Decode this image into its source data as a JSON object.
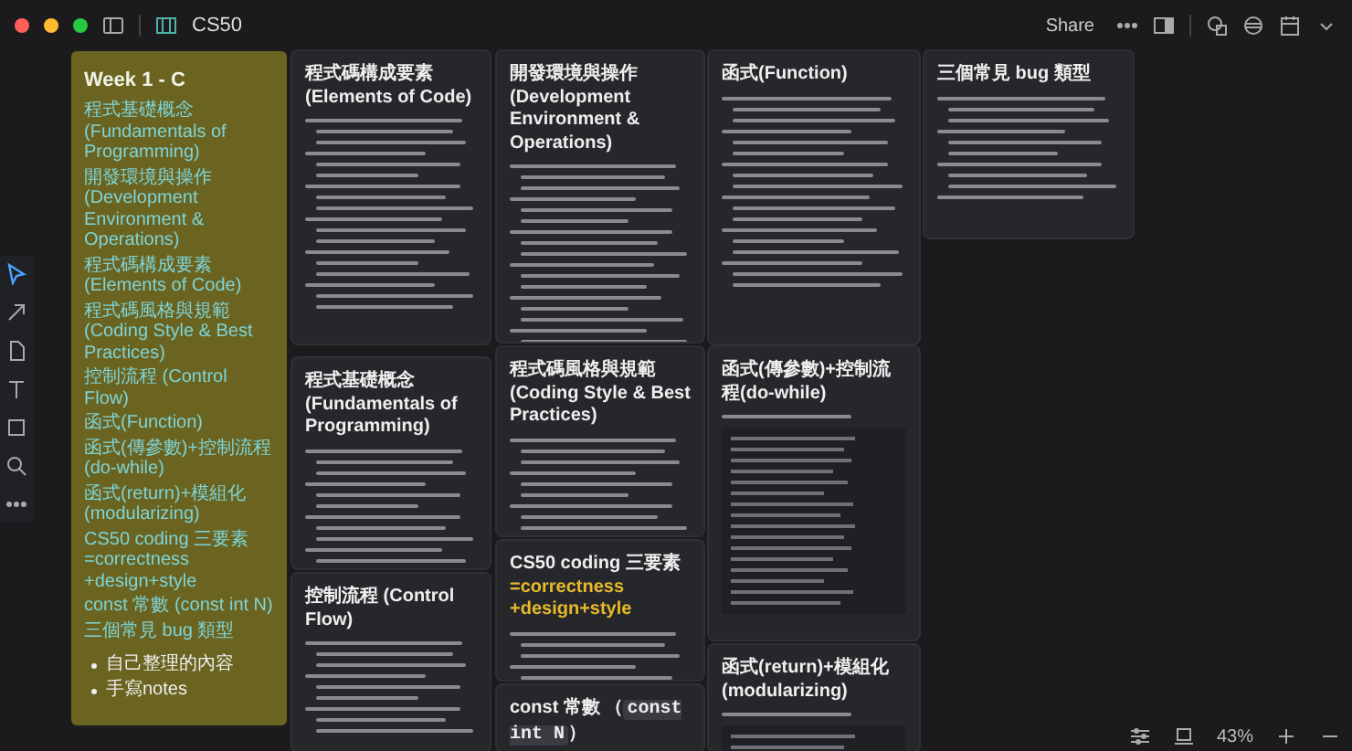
{
  "window": {
    "breadcrumb": "CS50",
    "share": "Share"
  },
  "overview_card": {
    "title": "Week 1 - C",
    "links": [
      "程式基礎概念 (Fundamentals of Programming)",
      "開發環境與操作 (Development Environment & Operations)",
      "程式碼構成要素 (Elements of Code)",
      "程式碼風格與規範 (Coding Style & Best Practices)",
      "控制流程 (Control Flow)",
      "函式(Function)",
      "函式(傳參數)+控制流程(do-while)",
      "函式(return)+模組化(modularizing)",
      "CS50 coding 三要素=correctness +design+style",
      "const 常數 (const int N)",
      "三個常見 bug 類型"
    ],
    "bullets": [
      "自己整理的內容",
      "手寫notes"
    ]
  },
  "cards": [
    {
      "title": [
        {
          "kind": "text",
          "text": "程式碼構成要素 (Elements of Code)"
        }
      ],
      "code_block": false
    },
    {
      "title": [
        {
          "kind": "text",
          "text": "程式基礎概念 (Fundamentals of Programming)"
        }
      ],
      "code_block": false
    },
    {
      "title": [
        {
          "kind": "text",
          "text": "控制流程 (Control Flow)"
        }
      ],
      "code_block": false
    },
    {
      "title": [
        {
          "kind": "text",
          "text": "開發環境與操作 (Development Environment & Operations)"
        }
      ],
      "code_block": false
    },
    {
      "title": [
        {
          "kind": "text",
          "text": "程式碼風格與規範 (Coding Style & Best Practices)"
        }
      ],
      "code_block": false
    },
    {
      "title": [
        {
          "kind": "text",
          "text": "CS50 coding 三要素"
        },
        {
          "kind": "accent",
          "text": "=correctness +design+style"
        }
      ],
      "code_block": false
    },
    {
      "title": [
        {
          "kind": "text",
          "text": "const 常數 （"
        },
        {
          "kind": "code",
          "text": "const int N"
        },
        {
          "kind": "text",
          "text": "）"
        }
      ]
    },
    {
      "title": [
        {
          "kind": "text",
          "text": "函式(Function)"
        }
      ],
      "code_block": false
    },
    {
      "title": [
        {
          "kind": "text",
          "text": "函式(傳參數)+控制流程(do-while)"
        }
      ],
      "code_block": true
    },
    {
      "title": [
        {
          "kind": "text",
          "text": "函式(return)+模組化 (modularizing)"
        }
      ],
      "code_block": true
    },
    {
      "title": [
        {
          "kind": "text",
          "text": "三個常見 bug 類型"
        }
      ],
      "code_block": false
    }
  ],
  "zoom": {
    "reading": "43%"
  }
}
